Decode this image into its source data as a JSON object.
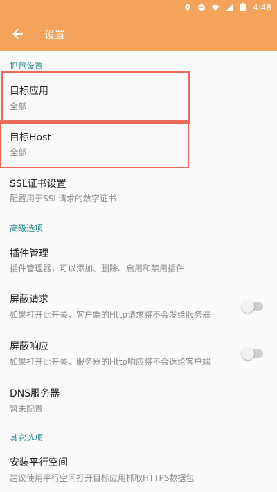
{
  "status": {
    "time": "4:48"
  },
  "appbar": {
    "title": "设置"
  },
  "sections": {
    "capture": "抓包设置",
    "advanced": "高级选项",
    "other": "其它选项"
  },
  "items": {
    "target_app": {
      "title": "目标应用",
      "summary": "全部"
    },
    "target_host": {
      "title": "目标Host",
      "summary": "全部"
    },
    "ssl": {
      "title": "SSL证书设置",
      "summary": "配置用于SSL请求的数字证书"
    },
    "plugins": {
      "title": "插件管理",
      "summary": "插件管理器，可以添加、删除、启用和禁用插件"
    },
    "block_request": {
      "title": "屏蔽请求",
      "summary": "如果打开此开关，客户端的Http请求将不会发给服务器",
      "enabled": false
    },
    "block_response": {
      "title": "屏蔽响应",
      "summary": "如果打开此开关，服务器的Http响应将不会返给客户端",
      "enabled": false
    },
    "dns": {
      "title": "DNS服务器",
      "summary": "暂未配置"
    },
    "parallel_space": {
      "title": "安装平行空间",
      "summary": "建议使用平行空间打开目标应用抓取HTTPS数据包"
    }
  },
  "colors": {
    "accent": "#f4a35d",
    "section": "#2a8c8f",
    "highlight": "#ea6b5c"
  }
}
